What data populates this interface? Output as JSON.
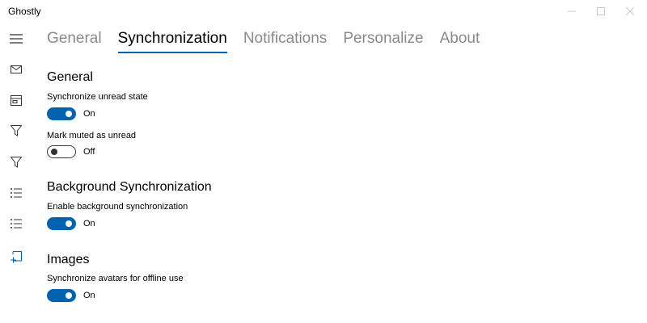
{
  "window": {
    "title": "Ghostly",
    "controls": {
      "minimize": "minimize-icon",
      "maximize": "maximize-icon",
      "close": "close-icon"
    }
  },
  "rail": {
    "items": [
      {
        "icon": "hamburger-icon"
      },
      {
        "icon": "mail-icon"
      },
      {
        "icon": "inbox-icon"
      },
      {
        "icon": "filter-icon"
      },
      {
        "icon": "filter-icon"
      },
      {
        "icon": "list-icon"
      },
      {
        "icon": "list-icon"
      },
      {
        "icon": "settings-page-icon",
        "active": true
      }
    ]
  },
  "tabs": [
    {
      "label": "General",
      "active": false
    },
    {
      "label": "Synchronization",
      "active": true
    },
    {
      "label": "Notifications",
      "active": false
    },
    {
      "label": "Personalize",
      "active": false
    },
    {
      "label": "About",
      "active": false
    }
  ],
  "sections": {
    "general": {
      "title": "General",
      "settings": [
        {
          "label": "Synchronize unread state",
          "state": "On",
          "on": true
        },
        {
          "label": "Mark muted as unread",
          "state": "Off",
          "on": false
        }
      ]
    },
    "background": {
      "title": "Background Synchronization",
      "settings": [
        {
          "label": "Enable background synchronization",
          "state": "On",
          "on": true
        }
      ]
    },
    "images": {
      "title": "Images",
      "settings": [
        {
          "label": "Synchronize avatars for offline use",
          "state": "On",
          "on": true
        }
      ]
    }
  },
  "colors": {
    "accent": "#0063b1",
    "inactive_tab": "#8a8a8a",
    "text": "#000000"
  }
}
